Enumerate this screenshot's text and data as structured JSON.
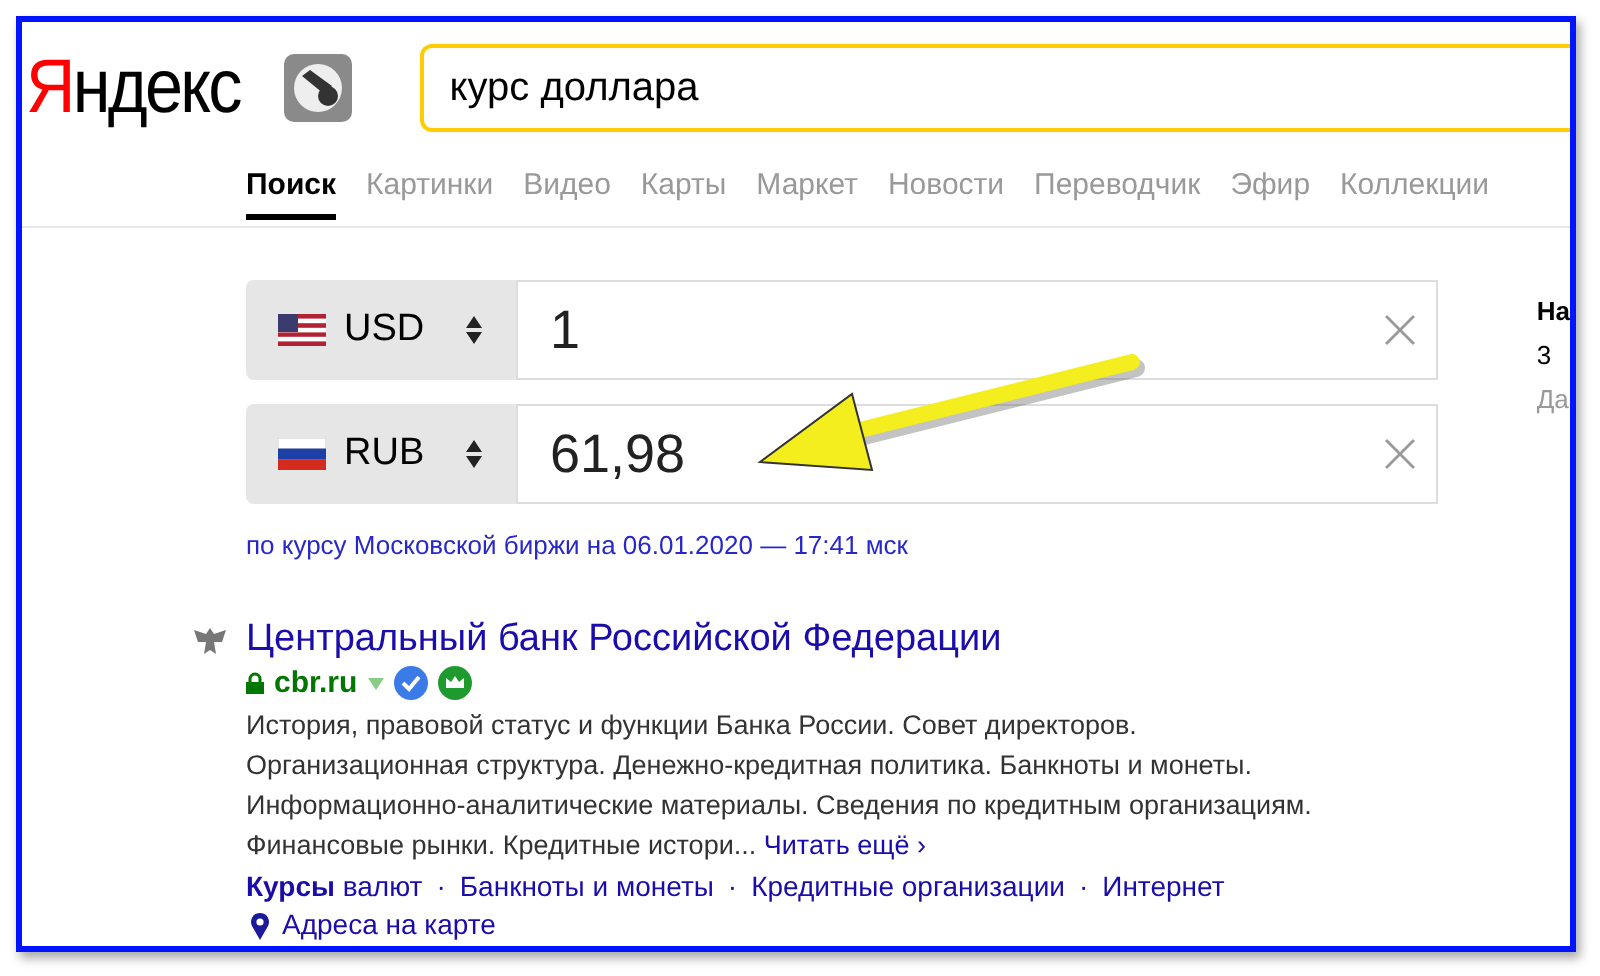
{
  "logo": {
    "first": "Я",
    "rest": "ндекс"
  },
  "search": {
    "value": "курс доллара"
  },
  "tabs": [
    {
      "label": "Поиск",
      "selected": true
    },
    {
      "label": "Картинки",
      "selected": false
    },
    {
      "label": "Видео",
      "selected": false
    },
    {
      "label": "Карты",
      "selected": false
    },
    {
      "label": "Маркет",
      "selected": false
    },
    {
      "label": "Новости",
      "selected": false
    },
    {
      "label": "Переводчик",
      "selected": false
    },
    {
      "label": "Эфир",
      "selected": false
    },
    {
      "label": "Коллекции",
      "selected": false
    }
  ],
  "converter": {
    "rows": [
      {
        "currency": "USD",
        "kind": "us",
        "value": "1"
      },
      {
        "currency": "RUB",
        "kind": "ru",
        "value": "61,98"
      }
    ],
    "source": "по курсу Московской биржи на 06.01.2020 — 17:41 мск"
  },
  "side": [
    {
      "text": "На",
      "kind": "heading"
    },
    {
      "text": "3",
      "kind": "plain"
    },
    {
      "text": "Да",
      "kind": "muted"
    }
  ],
  "result": {
    "title": "Центральный банк Российской Федерации",
    "url": "cbr.ru",
    "description": "История, правовой статус и функции Банка России. Совет директоров. Организационная структура. Денежно-кредитная политика. Банкноты и монеты. Информационно-аналитические материалы. Сведения по кредитным организациям. Финансовые рынки. Кредитные истори...",
    "read_more": "Читать ещё ›",
    "sitelinks": [
      "**Курсы** валют",
      "Банкноты и монеты",
      "Кредитные организации",
      "Интернет"
    ],
    "separator": "·",
    "address": "Адреса на карте"
  }
}
